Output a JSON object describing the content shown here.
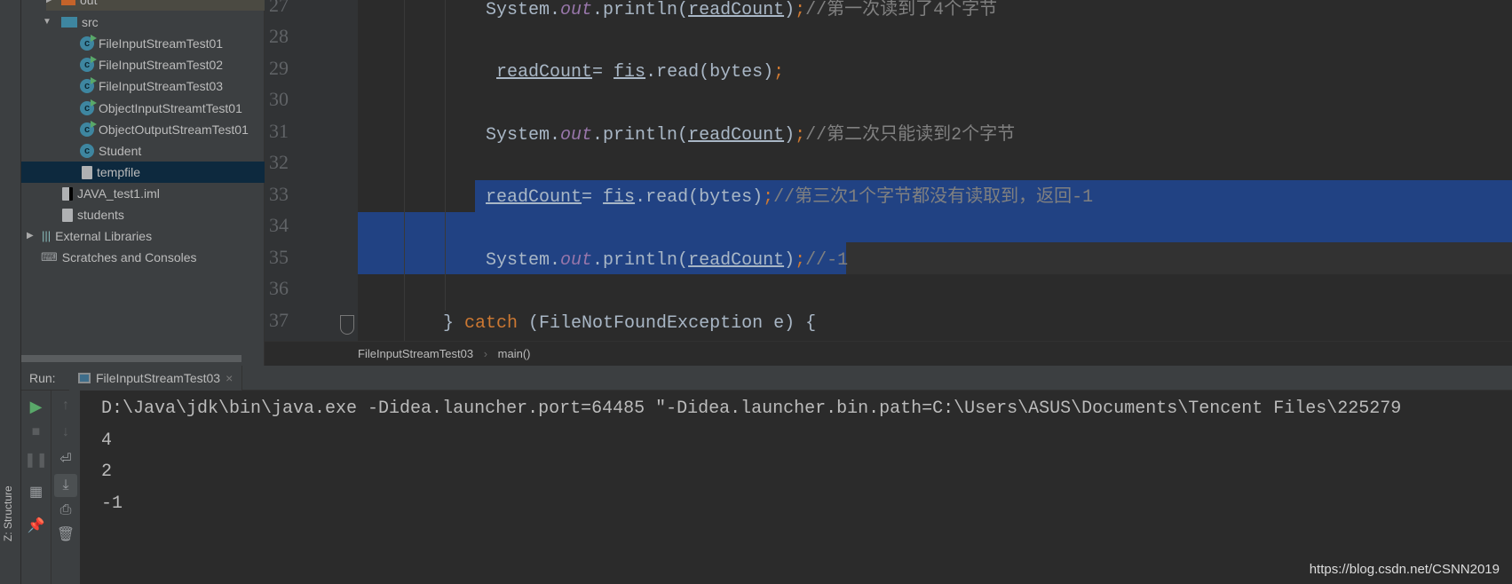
{
  "sidebar": {
    "structure_label": "Z: Structure"
  },
  "tree": {
    "items": [
      {
        "label": "out",
        "type": "folder-out"
      },
      {
        "label": "src",
        "type": "folder-src"
      },
      {
        "label": "FileInputStreamTest01",
        "type": "class-run"
      },
      {
        "label": "FileInputStreamTest02",
        "type": "class-run"
      },
      {
        "label": "FileInputStreamTest03",
        "type": "class-run"
      },
      {
        "label": "ObjectInputStreamtTest01",
        "type": "class-run"
      },
      {
        "label": "ObjectOutputStreamTest01",
        "type": "class-run"
      },
      {
        "label": "Student",
        "type": "class"
      },
      {
        "label": "tempfile",
        "type": "file",
        "selected": true
      },
      {
        "label": "JAVA_test1.iml",
        "type": "iml"
      },
      {
        "label": "students",
        "type": "file"
      },
      {
        "label": "External Libraries",
        "type": "libraries"
      },
      {
        "label": "Scratches and Consoles",
        "type": "scratches"
      }
    ]
  },
  "editor": {
    "line_numbers": [
      "27",
      "28",
      "29",
      "30",
      "31",
      "32",
      "33",
      "34",
      "35",
      "36",
      "37"
    ],
    "lines": {
      "l27": {
        "a": "System.",
        "b": "out",
        "c": ".println(",
        "d": "readCount",
        "e": ")",
        "f": ";",
        "g": "//第一次读到了4个字节"
      },
      "l29": {
        "a": "readCount",
        "b": "= ",
        "c": "fis",
        ".d": "",
        "d": ".read(bytes)",
        "f": ";"
      },
      "l31": {
        "a": "System.",
        "b": "out",
        "c": ".println(",
        "d": "readCount",
        "e": ")",
        "f": ";",
        "g": "//第二次只能读到2个字节"
      },
      "l33": {
        "a": "readCount",
        "b": "= ",
        "c": "fis",
        "d": ".read(bytes)",
        "f": ";",
        "g": "//第三次1个字节都没有读取到，返回-1"
      },
      "l35": {
        "a": "System.",
        "b": "out",
        "c": ".println(",
        "d": "readCount",
        "e": ")",
        "f": ";",
        "g": "//-1"
      },
      "l37": {
        "a": "} ",
        "b": "catch",
        "c": " (FileNotFoundException e) {"
      }
    },
    "selection_color": "#214283"
  },
  "breadcrumb": {
    "items": [
      "FileInputStreamTest03",
      "main()"
    ],
    "sep": "›"
  },
  "run": {
    "label": "Run:",
    "tab": "FileInputStreamTest03",
    "close": "×"
  },
  "console": {
    "lines": [
      "D:\\Java\\jdk\\bin\\java.exe -Didea.launcher.port=64485 \"-Didea.launcher.bin.path=C:\\Users\\ASUS\\Documents\\Tencent Files\\225279",
      "4",
      "2",
      "-1"
    ]
  },
  "watermark": "https://blog.csdn.net/CSNN2019"
}
